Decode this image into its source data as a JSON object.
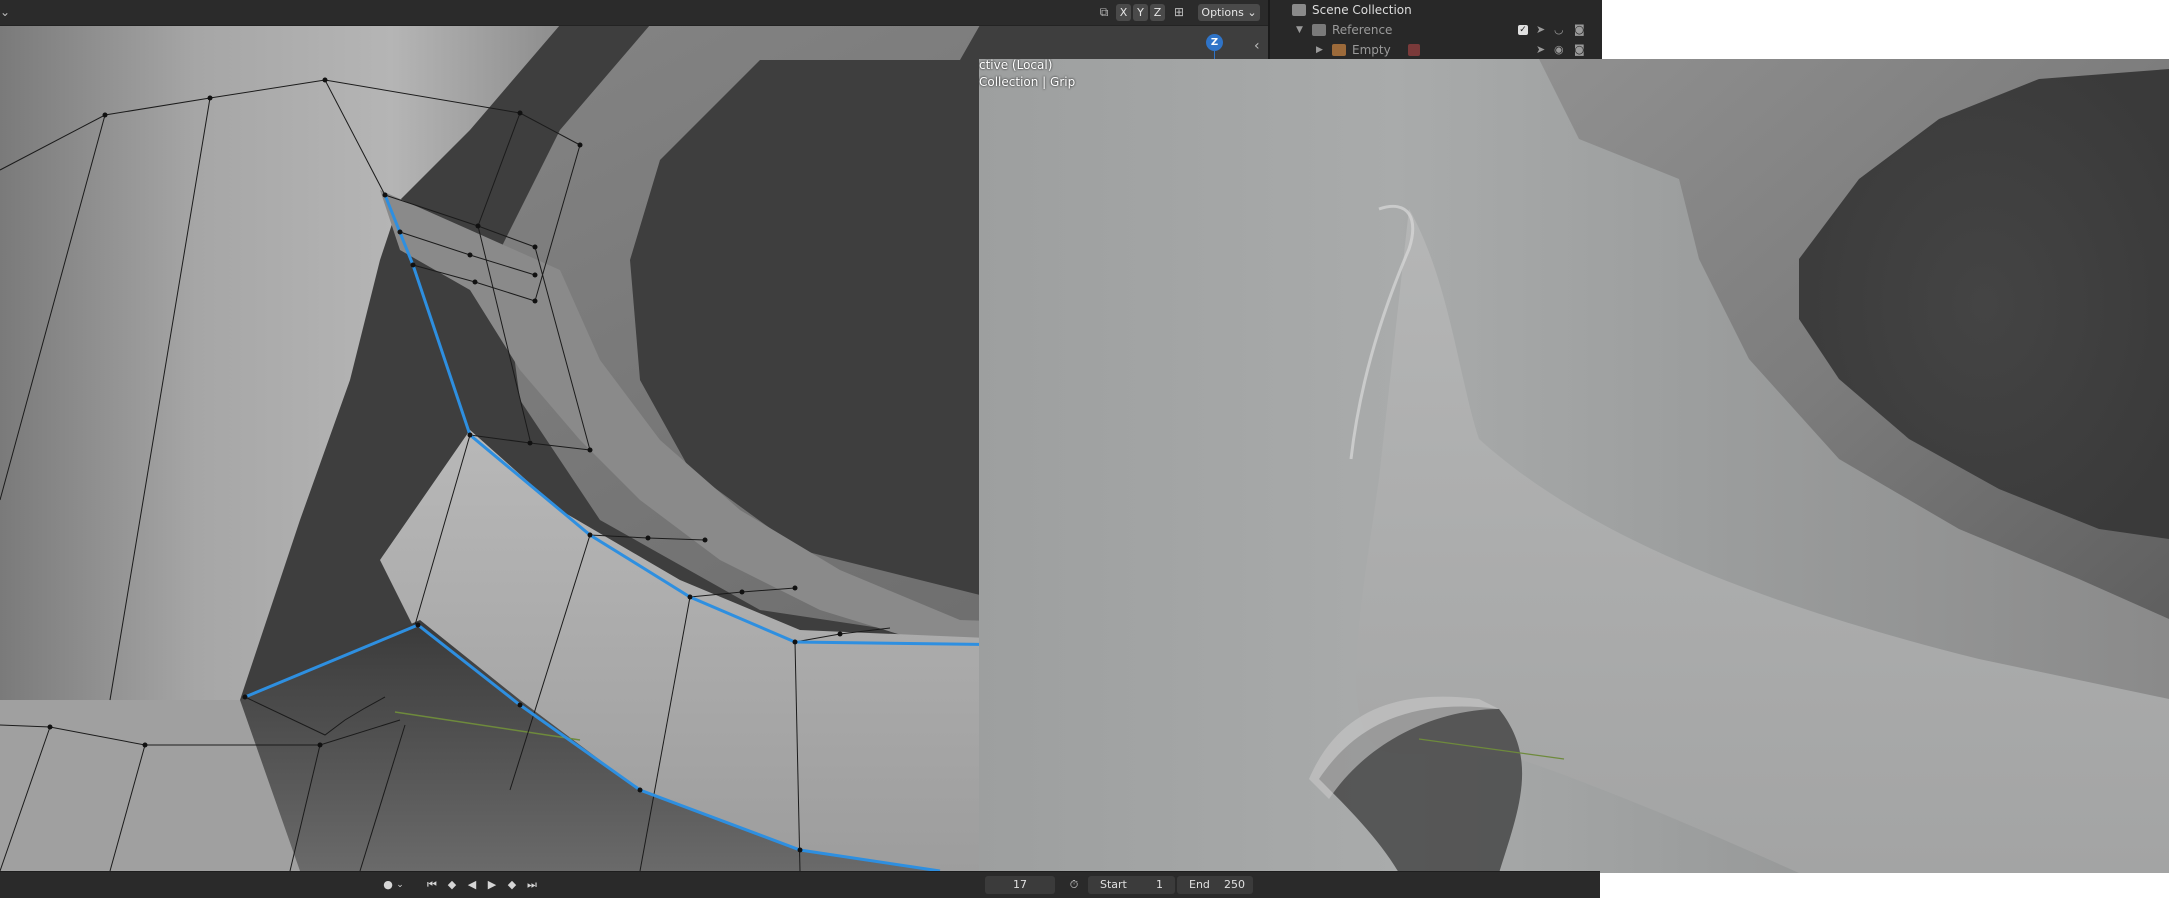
{
  "viewport": {
    "header": {
      "axis_x": "X",
      "axis_y": "Y",
      "axis_z": "Z",
      "options_label": "Options",
      "menu_chevron": "⌄",
      "gizmo_axis": "Z",
      "collapse_arrow": "‹"
    },
    "overlay": {
      "view_label": "ctive (Local)",
      "collection_label": "Collection | Grip"
    }
  },
  "timeline": {
    "current_frame": "17",
    "start_label": "Start",
    "start_value": "1",
    "end_label": "End",
    "end_value": "250"
  },
  "outliner": {
    "title": "Scene Collection",
    "items": [
      {
        "label": "Reference"
      },
      {
        "label": "Empty"
      }
    ]
  },
  "colors": {
    "selection_edge": "#2e8fe0",
    "axis_line": "#6e8a3c",
    "gizmo_z": "#2f74c8"
  }
}
